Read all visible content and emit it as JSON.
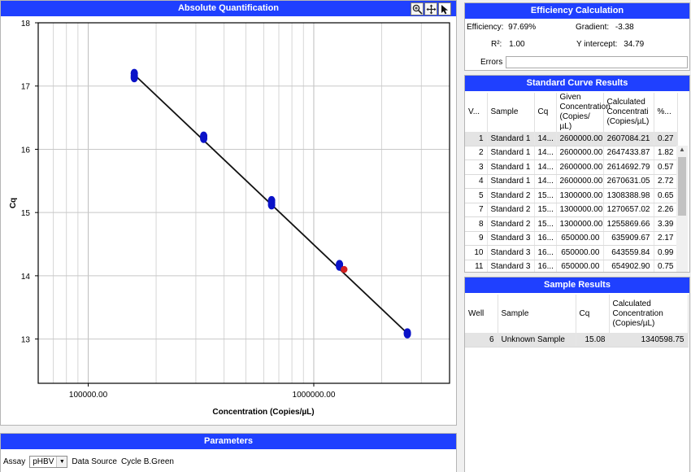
{
  "absolute_quantification": {
    "title": "Absolute Quantification",
    "tools": [
      "zoom-icon",
      "pan-icon",
      "select-pointer-icon"
    ]
  },
  "chart_data": {
    "type": "scatter",
    "x_scale": "log",
    "xlabel": "Concentration (Copies/µL)",
    "ylabel": "Cq",
    "xlim": [
      60000,
      4000000
    ],
    "ylim": [
      12.3,
      18
    ],
    "x_tick_labels": [
      "100000.00",
      "1000000.00"
    ],
    "y_ticks": [
      13,
      14,
      15,
      16,
      17,
      18
    ],
    "grid": true,
    "standards": [
      {
        "x": 160000,
        "y": 17.2
      },
      {
        "x": 160000,
        "y": 17.16
      },
      {
        "x": 160000,
        "y": 17.13
      },
      {
        "x": 325000,
        "y": 16.21
      },
      {
        "x": 325000,
        "y": 16.17
      },
      {
        "x": 650000,
        "y": 15.19
      },
      {
        "x": 650000,
        "y": 15.16
      },
      {
        "x": 650000,
        "y": 15.12
      },
      {
        "x": 1300000,
        "y": 14.18
      },
      {
        "x": 1300000,
        "y": 14.15
      },
      {
        "x": 2600000,
        "y": 13.1
      },
      {
        "x": 2600000,
        "y": 13.08
      }
    ],
    "unknowns": [
      {
        "x": 1340598.75,
        "y": 14.1
      }
    ],
    "fit_line": {
      "x": [
        160000,
        2600000
      ],
      "y": [
        17.18,
        13.09
      ]
    },
    "colors": {
      "standard": "#0a12c8",
      "unknown": "#d42020",
      "line": "#111111"
    }
  },
  "efficiency": {
    "title": "Efficiency Calculation",
    "efficiency_label": "Efficiency:",
    "efficiency_value": "97.69%",
    "gradient_label": "Gradient:",
    "gradient_value": "-3.38",
    "r2_label": "R²:",
    "r2_value": "1.00",
    "yint_label": "Y intercept:",
    "yint_value": "34.79",
    "errors_label": "Errors",
    "errors_value": ""
  },
  "standard_curve": {
    "title": "Standard Curve Results",
    "headers": [
      "V...",
      "Sample",
      "Cq",
      "Given Concentration (Copies/µL)",
      "Calculated Concentrati (Copies/µL)",
      "%..."
    ],
    "rows": [
      [
        "1",
        "Standard 1",
        "14...",
        "2600000.00",
        "2607084.21",
        "0.27"
      ],
      [
        "2",
        "Standard 1",
        "14...",
        "2600000.00",
        "2647433.87",
        "1.82"
      ],
      [
        "3",
        "Standard 1",
        "14...",
        "2600000.00",
        "2614692.79",
        "0.57"
      ],
      [
        "4",
        "Standard 1",
        "14...",
        "2600000.00",
        "2670631.05",
        "2.72"
      ],
      [
        "5",
        "Standard 2",
        "15...",
        "1300000.00",
        "1308388.98",
        "0.65"
      ],
      [
        "7",
        "Standard 2",
        "15...",
        "1300000.00",
        "1270657.02",
        "2.26"
      ],
      [
        "8",
        "Standard 2",
        "15...",
        "1300000.00",
        "1255869.66",
        "3.39"
      ],
      [
        "9",
        "Standard 3",
        "16...",
        "650000.00",
        "635909.67",
        "2.17"
      ],
      [
        "10",
        "Standard 3",
        "16...",
        "650000.00",
        "643559.84",
        "0.99"
      ],
      [
        "11",
        "Standard 3",
        "16...",
        "650000.00",
        "654902.90",
        "0.75"
      ]
    ]
  },
  "sample_results": {
    "title": "Sample Results",
    "headers": [
      "Well",
      "Sample",
      "Cq",
      "Calculated Concentration (Copies/µL)"
    ],
    "rows": [
      [
        "6",
        "Unknown Sample",
        "15.08",
        "1340598.75"
      ]
    ]
  },
  "parameters": {
    "title": "Parameters",
    "assay_label": "Assay",
    "assay_value": "pHBV",
    "data_source_label": "Data Source",
    "data_source_value": "Cycle B.Green"
  }
}
